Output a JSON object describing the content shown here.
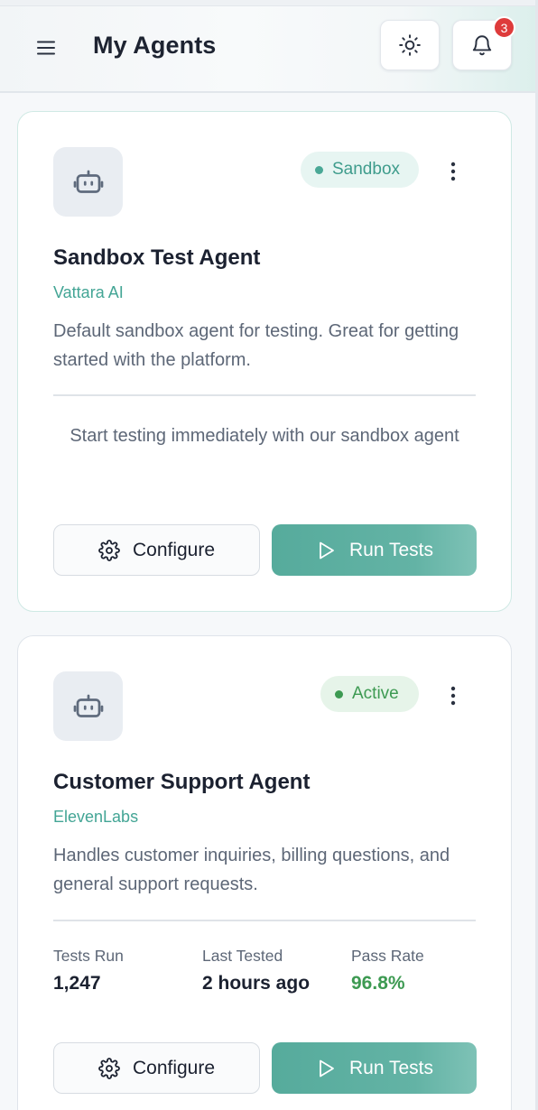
{
  "header": {
    "title": "My Agents",
    "notification_count": "3",
    "icons": {
      "menu": "hamburger-menu-icon",
      "theme": "sun-icon",
      "notifications": "bell-icon"
    }
  },
  "colors": {
    "accent": "#56ab9c",
    "active_green": "#3d9a52",
    "notif_red": "#de3b3b"
  },
  "agents": [
    {
      "status": "Sandbox",
      "name": "Sandbox Test Agent",
      "provider": "Vattara AI",
      "description": "Default sandbox agent for testing. Great for getting started with the platform.",
      "hint": "Start testing immediately with our sandbox agent",
      "configure_label": "Configure",
      "run_label": "Run Tests"
    },
    {
      "status": "Active",
      "name": "Customer Support Agent",
      "provider": "ElevenLabs",
      "description": "Handles customer inquiries, billing questions, and general support requests.",
      "stats": [
        {
          "label": "Tests Run",
          "value": "1,247"
        },
        {
          "label": "Last Tested",
          "value": "2 hours ago"
        },
        {
          "label": "Pass Rate",
          "value": "96.8%"
        }
      ],
      "configure_label": "Configure",
      "run_label": "Run Tests"
    }
  ]
}
